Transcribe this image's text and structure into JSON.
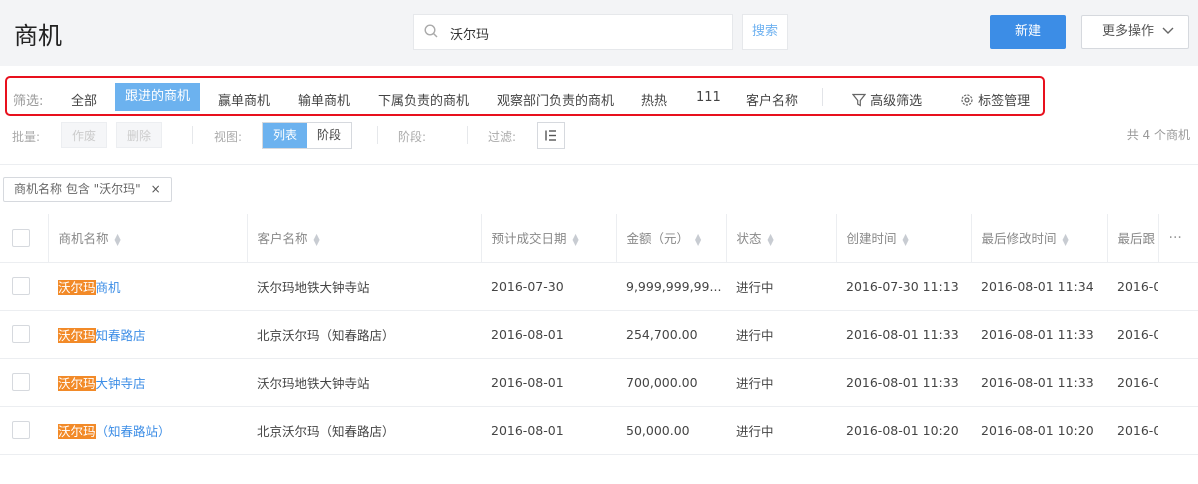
{
  "header": {
    "title": "商机",
    "search_value": "沃尔玛",
    "search_button": "搜索",
    "new_button": "新建",
    "more_button": "更多操作"
  },
  "filters": {
    "label": "筛选:",
    "items": [
      "全部",
      "跟进的商机",
      "赢单商机",
      "输单商机",
      "下属负责的商机",
      "观察部门负责的商机",
      "热热",
      "111",
      "客户名称"
    ],
    "active_index": 1,
    "advanced": "高级筛选",
    "tags": "标签管理"
  },
  "toolbar": {
    "bulk_label": "批量:",
    "void_button": "作废",
    "delete_button": "删除",
    "view_label": "视图:",
    "view_list": "列表",
    "view_stage": "阶段",
    "stage_label": "阶段:",
    "filter_label": "过滤:",
    "count_text": "共 4 个商机"
  },
  "chip": {
    "text": "商机名称 包含 \"沃尔玛\"",
    "close": "×"
  },
  "table": {
    "columns": [
      "商机名称",
      "客户名称",
      "预计成交日期",
      "金额（元）",
      "状态",
      "创建时间",
      "最后修改时间",
      "最后跟"
    ],
    "more": "···",
    "rows": [
      {
        "name_hl": "沃尔玛",
        "name_rest": "商机",
        "customer": "沃尔玛地铁大钟寺站",
        "date": "2016-07-30",
        "amount": "9,999,999,99...",
        "status": "进行中",
        "created": "2016-07-30 11:13",
        "modified": "2016-08-01 11:34",
        "last": "2016-0"
      },
      {
        "name_hl": "沃尔玛",
        "name_rest": "知春路店",
        "customer": "北京沃尔玛（知春路店）",
        "date": "2016-08-01",
        "amount": "254,700.00",
        "status": "进行中",
        "created": "2016-08-01 11:33",
        "modified": "2016-08-01 11:33",
        "last": "2016-0"
      },
      {
        "name_hl": "沃尔玛",
        "name_rest": "大钟寺店",
        "customer": "沃尔玛地铁大钟寺站",
        "date": "2016-08-01",
        "amount": "700,000.00",
        "status": "进行中",
        "created": "2016-08-01 11:33",
        "modified": "2016-08-01 11:33",
        "last": "2016-0"
      },
      {
        "name_hl": "沃尔玛",
        "name_rest": "（知春路站）",
        "customer": "北京沃尔玛（知春路店）",
        "date": "2016-08-01",
        "amount": "50,000.00",
        "status": "进行中",
        "created": "2016-08-01 10:20",
        "modified": "2016-08-01 10:20",
        "last": "2016-0"
      }
    ]
  },
  "colors": {
    "primary": "#3c8de6",
    "active_tab": "#6cb2ef",
    "highlight": "#f28a28",
    "annotation_box": "#e8101d"
  }
}
